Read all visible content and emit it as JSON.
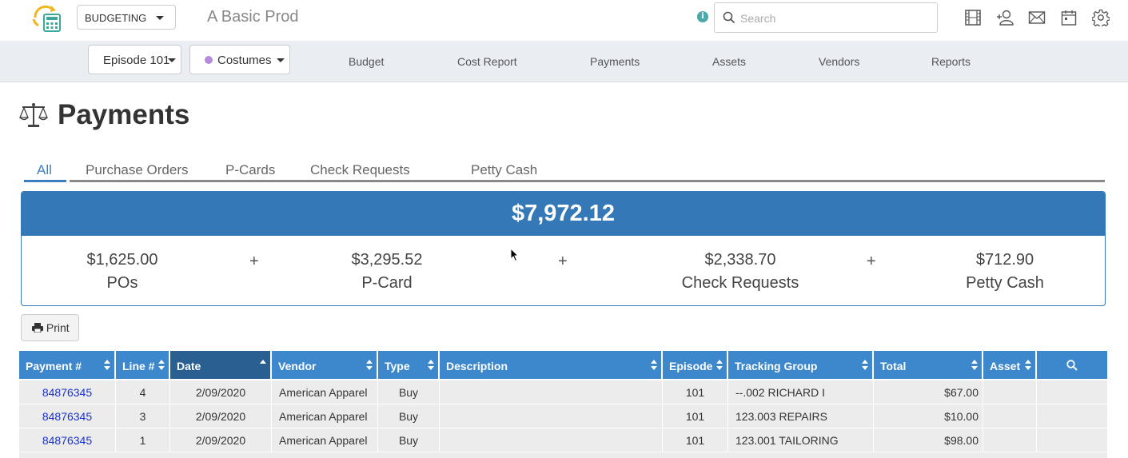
{
  "app": {
    "module": "BUDGETING",
    "production_title": "A Basic Prod",
    "search_placeholder": "Search",
    "info_icon": "i"
  },
  "subnav": {
    "episode": "Episode 101",
    "department": "Costumes",
    "department_color": "#b58cd8",
    "links": [
      "Budget",
      "Cost Report",
      "Payments",
      "Assets",
      "Vendors",
      "Reports"
    ]
  },
  "page": {
    "title": "Payments"
  },
  "tabs": [
    "All",
    "Purchase Orders",
    "P-Cards",
    "Check Requests",
    "Petty Cash"
  ],
  "summary": {
    "total": "$7,972.12",
    "plus": "+",
    "items": [
      {
        "amount": "$1,625.00",
        "label": "POs"
      },
      {
        "amount": "$3,295.52",
        "label": "P-Card"
      },
      {
        "amount": "$2,338.70",
        "label": "Check Requests"
      },
      {
        "amount": "$712.90",
        "label": "Petty Cash"
      }
    ]
  },
  "print_label": "Print",
  "table": {
    "columns": [
      "Payment #",
      "Line #",
      "Date",
      "Vendor",
      "Type",
      "Description",
      "Episode",
      "Tracking Group",
      "Total",
      "Asset"
    ],
    "rows": [
      {
        "payment": "84876345",
        "line": "4",
        "date": "2/09/2020",
        "vendor": "American Apparel",
        "type": "Buy",
        "description": "",
        "episode": "101",
        "tracking": "--.002 RICHARD I",
        "total": "$67.00",
        "asset": ""
      },
      {
        "payment": "84876345",
        "line": "3",
        "date": "2/09/2020",
        "vendor": "American Apparel",
        "type": "Buy",
        "description": "",
        "episode": "101",
        "tracking": "123.003 REPAIRS",
        "total": "$10.00",
        "asset": ""
      },
      {
        "payment": "84876345",
        "line": "1",
        "date": "2/09/2020",
        "vendor": "American Apparel",
        "type": "Buy",
        "description": "",
        "episode": "101",
        "tracking": "123.001 TAILORING",
        "total": "$98.00",
        "asset": ""
      }
    ]
  }
}
